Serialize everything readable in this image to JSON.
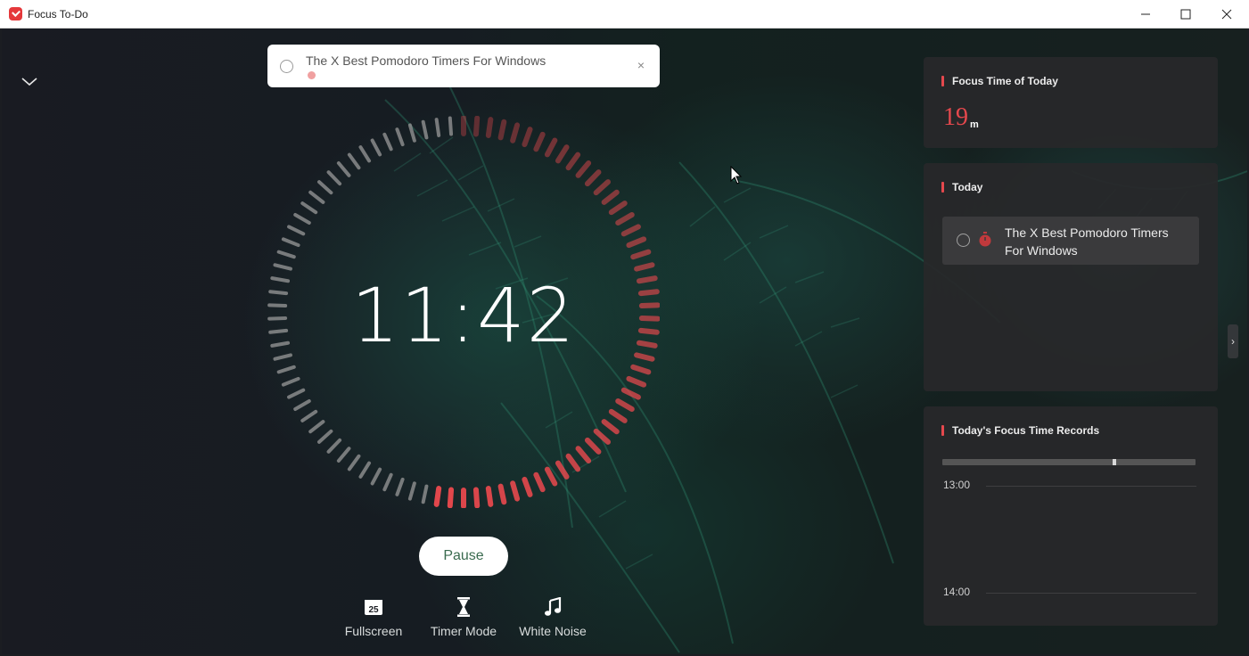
{
  "window": {
    "title": "Focus To-Do"
  },
  "current_task": {
    "title": "The X Best Pomodoro Timers For Windows",
    "close_symbol": "×"
  },
  "timer": {
    "display": "11:42",
    "progress": 0.53,
    "pause_label": "Pause",
    "accent_color": "#e5484d"
  },
  "tools": [
    {
      "label": "Fullscreen",
      "icon": "calendar-25-icon",
      "badge": "25"
    },
    {
      "label": "Timer Mode",
      "icon": "hourglass-icon"
    },
    {
      "label": "White Noise",
      "icon": "music-note-icon"
    }
  ],
  "panels": {
    "focus_time": {
      "heading": "Focus Time of Today",
      "value": "19",
      "unit": "m"
    },
    "today": {
      "heading": "Today",
      "task_title": "The X Best Pomodoro Timers For Windows"
    },
    "records": {
      "heading": "Today's Focus Time Records",
      "times": [
        "13:00",
        "14:00"
      ]
    }
  },
  "side_toggle": "›"
}
